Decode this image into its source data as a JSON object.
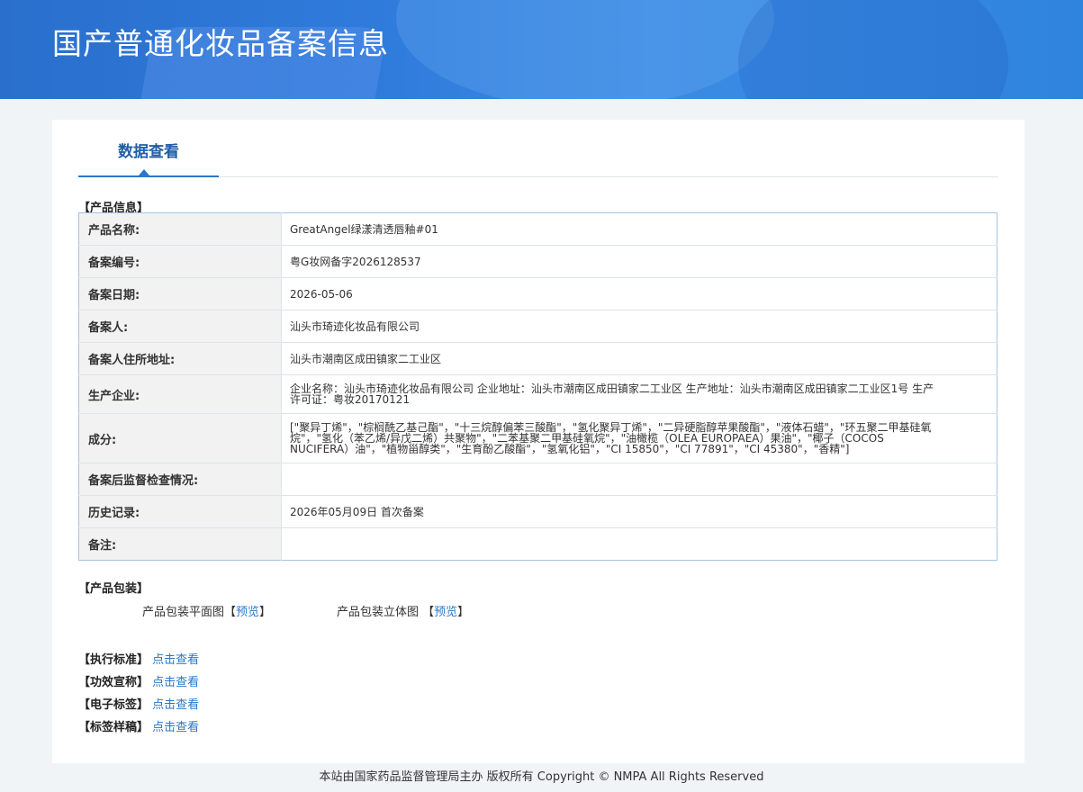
{
  "header": {
    "title": "国产普通化妆品备案信息"
  },
  "tabs": [
    {
      "label": "数据查看"
    }
  ],
  "product_info": {
    "section_title": "【产品信息】",
    "rows": [
      {
        "label": "产品名称:",
        "value": "GreatAngel绿漾清透唇釉#01"
      },
      {
        "label": "备案编号:",
        "value": "粤G妆网备字2026128537"
      },
      {
        "label": "备案日期:",
        "value": "2026-05-06"
      },
      {
        "label": "备案人:",
        "value": "汕头市琦迹化妆品有限公司"
      },
      {
        "label": "备案人住所地址:",
        "value": "汕头市潮南区成田镇家二工业区"
      },
      {
        "label": "生产企业:",
        "value": "企业名称：汕头市琦迹化妆品有限公司 企业地址：汕头市潮南区成田镇家二工业区 生产地址：汕头市潮南区成田镇家二工业区1号 生产许可证：粤妆20170121"
      },
      {
        "label": "成分:",
        "value": "[\"聚异丁烯\"，\"棕榈酰乙基己酯\"，\"十三烷醇偏苯三酸酯\"，\"氢化聚异丁烯\"，\"二异硬脂醇苹果酸酯\"，\"液体石蜡\"，\"环五聚二甲基硅氧烷\"，\"氢化（苯乙烯/异戊二烯）共聚物\"，\"二苯基聚二甲基硅氧烷\"，\"油橄榄（OLEA EUROPAEA）果油\"，\"椰子（COCOS NUCIFERA）油\"，\"植物甾醇类\"，\"生育酚乙酸酯\"，\"氢氧化铝\"，\"CI 15850\"，\"CI 77891\"，\"CI 45380\"，\"香精\"]"
      },
      {
        "label": "备案后监督检查情况:",
        "value": ""
      },
      {
        "label": "历史记录:",
        "value": "2026年05月09日 首次备案"
      },
      {
        "label": "备注:",
        "value": ""
      }
    ]
  },
  "packaging": {
    "section_title": "【产品包装】",
    "items": [
      {
        "label": "产品包装平面图",
        "open": "【",
        "link": "预览",
        "close": "】"
      },
      {
        "label": "产品包装立体图",
        "open": " 【",
        "link": "预览",
        "close": "】"
      }
    ]
  },
  "standards": [
    {
      "label": "【执行标准】",
      "link": "点击查看"
    },
    {
      "label": "【功效宣称】",
      "link": "点击查看"
    },
    {
      "label": "【电子标签】",
      "link": "点击查看"
    },
    {
      "label": "【标签样稿】",
      "link": "点击查看"
    }
  ],
  "footer": {
    "text": "本站由国家药品监督管理局主办 版权所有 Copyright © NMPA All Rights Reserved"
  }
}
